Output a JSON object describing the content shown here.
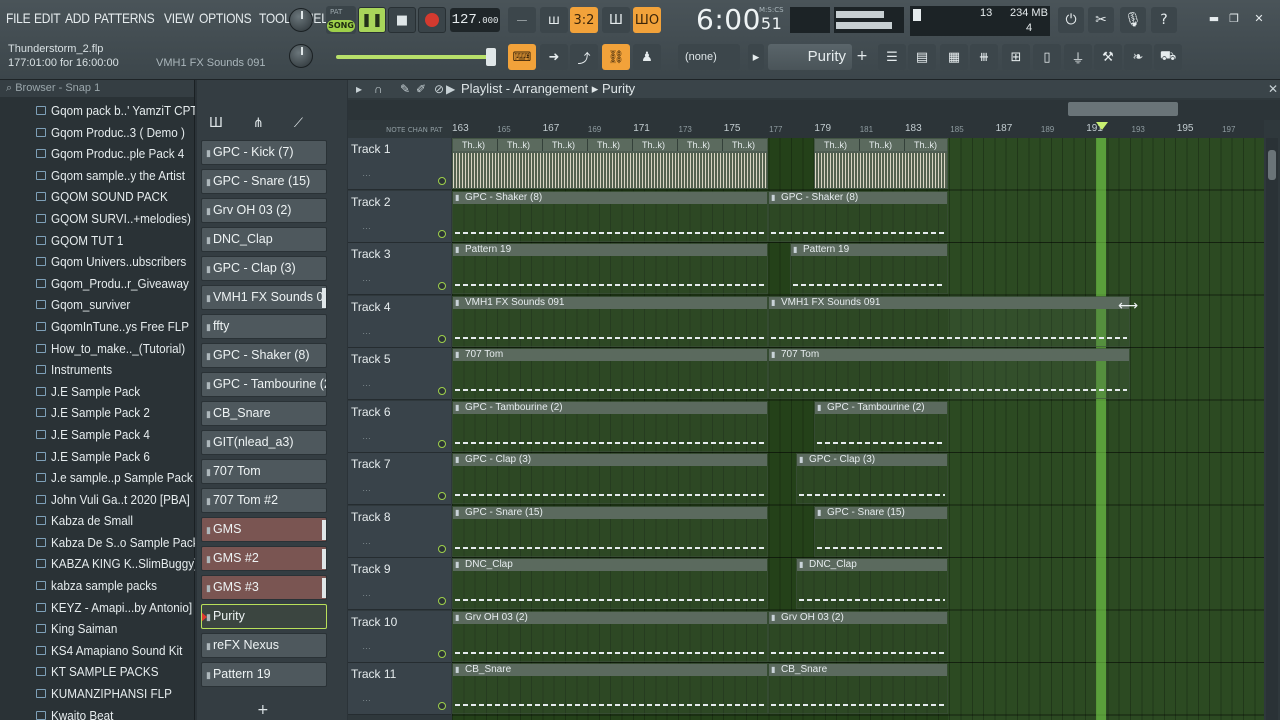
{
  "menu": [
    "FILE",
    "EDIT",
    "ADD",
    "PATTERNS",
    "VIEW",
    "OPTIONS",
    "TOOLS",
    "HELP"
  ],
  "project": {
    "file": "Thunderstorm_2.flp",
    "position": "177:01:00 for 16:00:00",
    "hint": "VMH1 FX Sounds 091"
  },
  "transport": {
    "pat_label": "PAT",
    "song_label": "SONG",
    "tempo": "127",
    "tempo_frac": ".000",
    "time": "6:00",
    "time_sec": "51",
    "time_mode": "M:S:CS"
  },
  "cpu": {
    "value": "13",
    "memory": "234 MB",
    "polyphony": "4"
  },
  "pattern_selector": "(none)",
  "current_pattern": "Purity",
  "browser": {
    "title": "Browser - Snap 1",
    "items": [
      "Gqom pack b..' YamziT CPT",
      "Gqom Produc..3 ( Demo )",
      "Gqom Produc..ple Pack 4",
      "Gqom sample..y the Artist",
      "GQOM SOUND PACK",
      "GQOM SURVI..+melodies)",
      "GQOM TUT 1",
      "Gqom Univers..ubscribers",
      "Gqom_Produ..r_Giveaway",
      "Gqom_surviver",
      "GqomInTune..ys Free FLP",
      "How_to_make.._(Tutorial)",
      "Instruments",
      "J.E Sample Pack",
      "J.E Sample Pack 2",
      "J.E Sample Pack 4",
      "J.E Sample Pack 6",
      "J.e sample..p Sample Pack",
      "John Vuli Ga..t 2020 [PBA]",
      "Kabza de Small",
      "Kabza De S..o Sample Pack",
      "KABZA KING K..SlimBuggy)",
      "kabza sample packs",
      "KEYZ - Amapi...by Antonio]",
      "King Saiman",
      "KS4 Amapiano Sound Kit",
      "KT SAMPLE PACKS",
      "KUMANZIPHANSI FLP",
      "Kwaito Beat"
    ]
  },
  "channels": [
    "GPC - Kick  (7)",
    "GPC - Snare (15)",
    "Grv OH 03 (2)",
    "DNC_Clap",
    "GPC - Clap (3)",
    "VMH1 FX Sounds 091",
    "ffty",
    "GPC - Shaker (8)",
    "GPC - Tambourine (2)",
    "CB_Snare",
    "GIT(nlead_a3)",
    "707 Tom",
    "707 Tom #2",
    "GMS",
    "GMS #2",
    "GMS #3",
    "Purity",
    "reFX Nexus",
    "Pattern 19"
  ],
  "playlist": {
    "title": "Playlist - Arrangement",
    "pattern": "Purity",
    "ruler_labels": [
      "NOTE",
      "CHAN",
      "PAT"
    ],
    "bars": [
      "163",
      "165",
      "167",
      "169",
      "171",
      "173",
      "175",
      "177",
      "179",
      "181",
      "183",
      "185",
      "187",
      "189",
      "191",
      "193",
      "195",
      "197"
    ],
    "tracks": [
      "Track 1",
      "Track 2",
      "Track 3",
      "Track 4",
      "Track 5",
      "Track 6",
      "Track 7",
      "Track 8",
      "Track 9",
      "Track 10",
      "Track 11"
    ],
    "audio_clip_label": "Th..k)",
    "clips": [
      {
        "track": 1,
        "label": "GPC - Shaker (8)"
      },
      {
        "track": 1,
        "label": "GPC - Shaker (8)"
      },
      {
        "track": 2,
        "label": "Pattern 19"
      },
      {
        "track": 2,
        "label": "Pattern 19"
      },
      {
        "track": 3,
        "label": "VMH1 FX Sounds 091"
      },
      {
        "track": 3,
        "label": "VMH1 FX Sounds 091"
      },
      {
        "track": 4,
        "label": "707 Tom"
      },
      {
        "track": 4,
        "label": "707 Tom"
      },
      {
        "track": 5,
        "label": "GPC - Tambourine (2)"
      },
      {
        "track": 5,
        "label": "GPC - Tambourine (2)"
      },
      {
        "track": 6,
        "label": "GPC - Clap (3)"
      },
      {
        "track": 6,
        "label": "GPC - Clap (3)"
      },
      {
        "track": 7,
        "label": "GPC - Snare (15)"
      },
      {
        "track": 7,
        "label": "GPC - Snare (15)"
      },
      {
        "track": 8,
        "label": "DNC_Clap"
      },
      {
        "track": 8,
        "label": "DNC_Clap"
      },
      {
        "track": 9,
        "label": "Grv OH 03 (2)"
      },
      {
        "track": 9,
        "label": "Grv OH 03 (2)"
      },
      {
        "track": 10,
        "label": "CB_Snare"
      },
      {
        "track": 10,
        "label": "CB_Snare"
      }
    ]
  },
  "colors": {
    "accent_green": "#9ed04a",
    "record_red": "#d43a2f",
    "tool_orange": "#f2a23a"
  }
}
